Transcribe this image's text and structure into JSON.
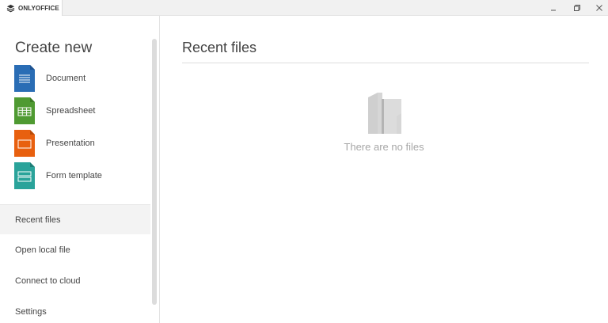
{
  "titlebar": {
    "app_name": "ONLYOFFICE",
    "controls": {
      "minimize": "minimize-icon",
      "restore": "restore-icon",
      "close": "close-icon"
    }
  },
  "sidebar": {
    "create_title": "Create new",
    "create_items": [
      {
        "label": "Document",
        "icon": "document-icon",
        "color": "#2a6db5"
      },
      {
        "label": "Spreadsheet",
        "icon": "spreadsheet-icon",
        "color": "#4f9a32"
      },
      {
        "label": "Presentation",
        "icon": "presentation-icon",
        "color": "#e8600f"
      },
      {
        "label": "Form template",
        "icon": "form-template-icon",
        "color": "#2aa39a"
      }
    ],
    "nav_items": [
      {
        "label": "Recent files",
        "active": true
      },
      {
        "label": "Open local file",
        "active": false
      },
      {
        "label": "Connect to cloud",
        "active": false
      },
      {
        "label": "Settings",
        "active": false
      }
    ]
  },
  "main": {
    "title": "Recent files",
    "empty_message": "There are no files"
  },
  "colors": {
    "accent_document": "#2a6db5",
    "accent_spreadsheet": "#4f9a32",
    "accent_presentation": "#e8600f",
    "accent_form": "#2aa39a",
    "active_nav_bg": "#f3f3f3"
  }
}
